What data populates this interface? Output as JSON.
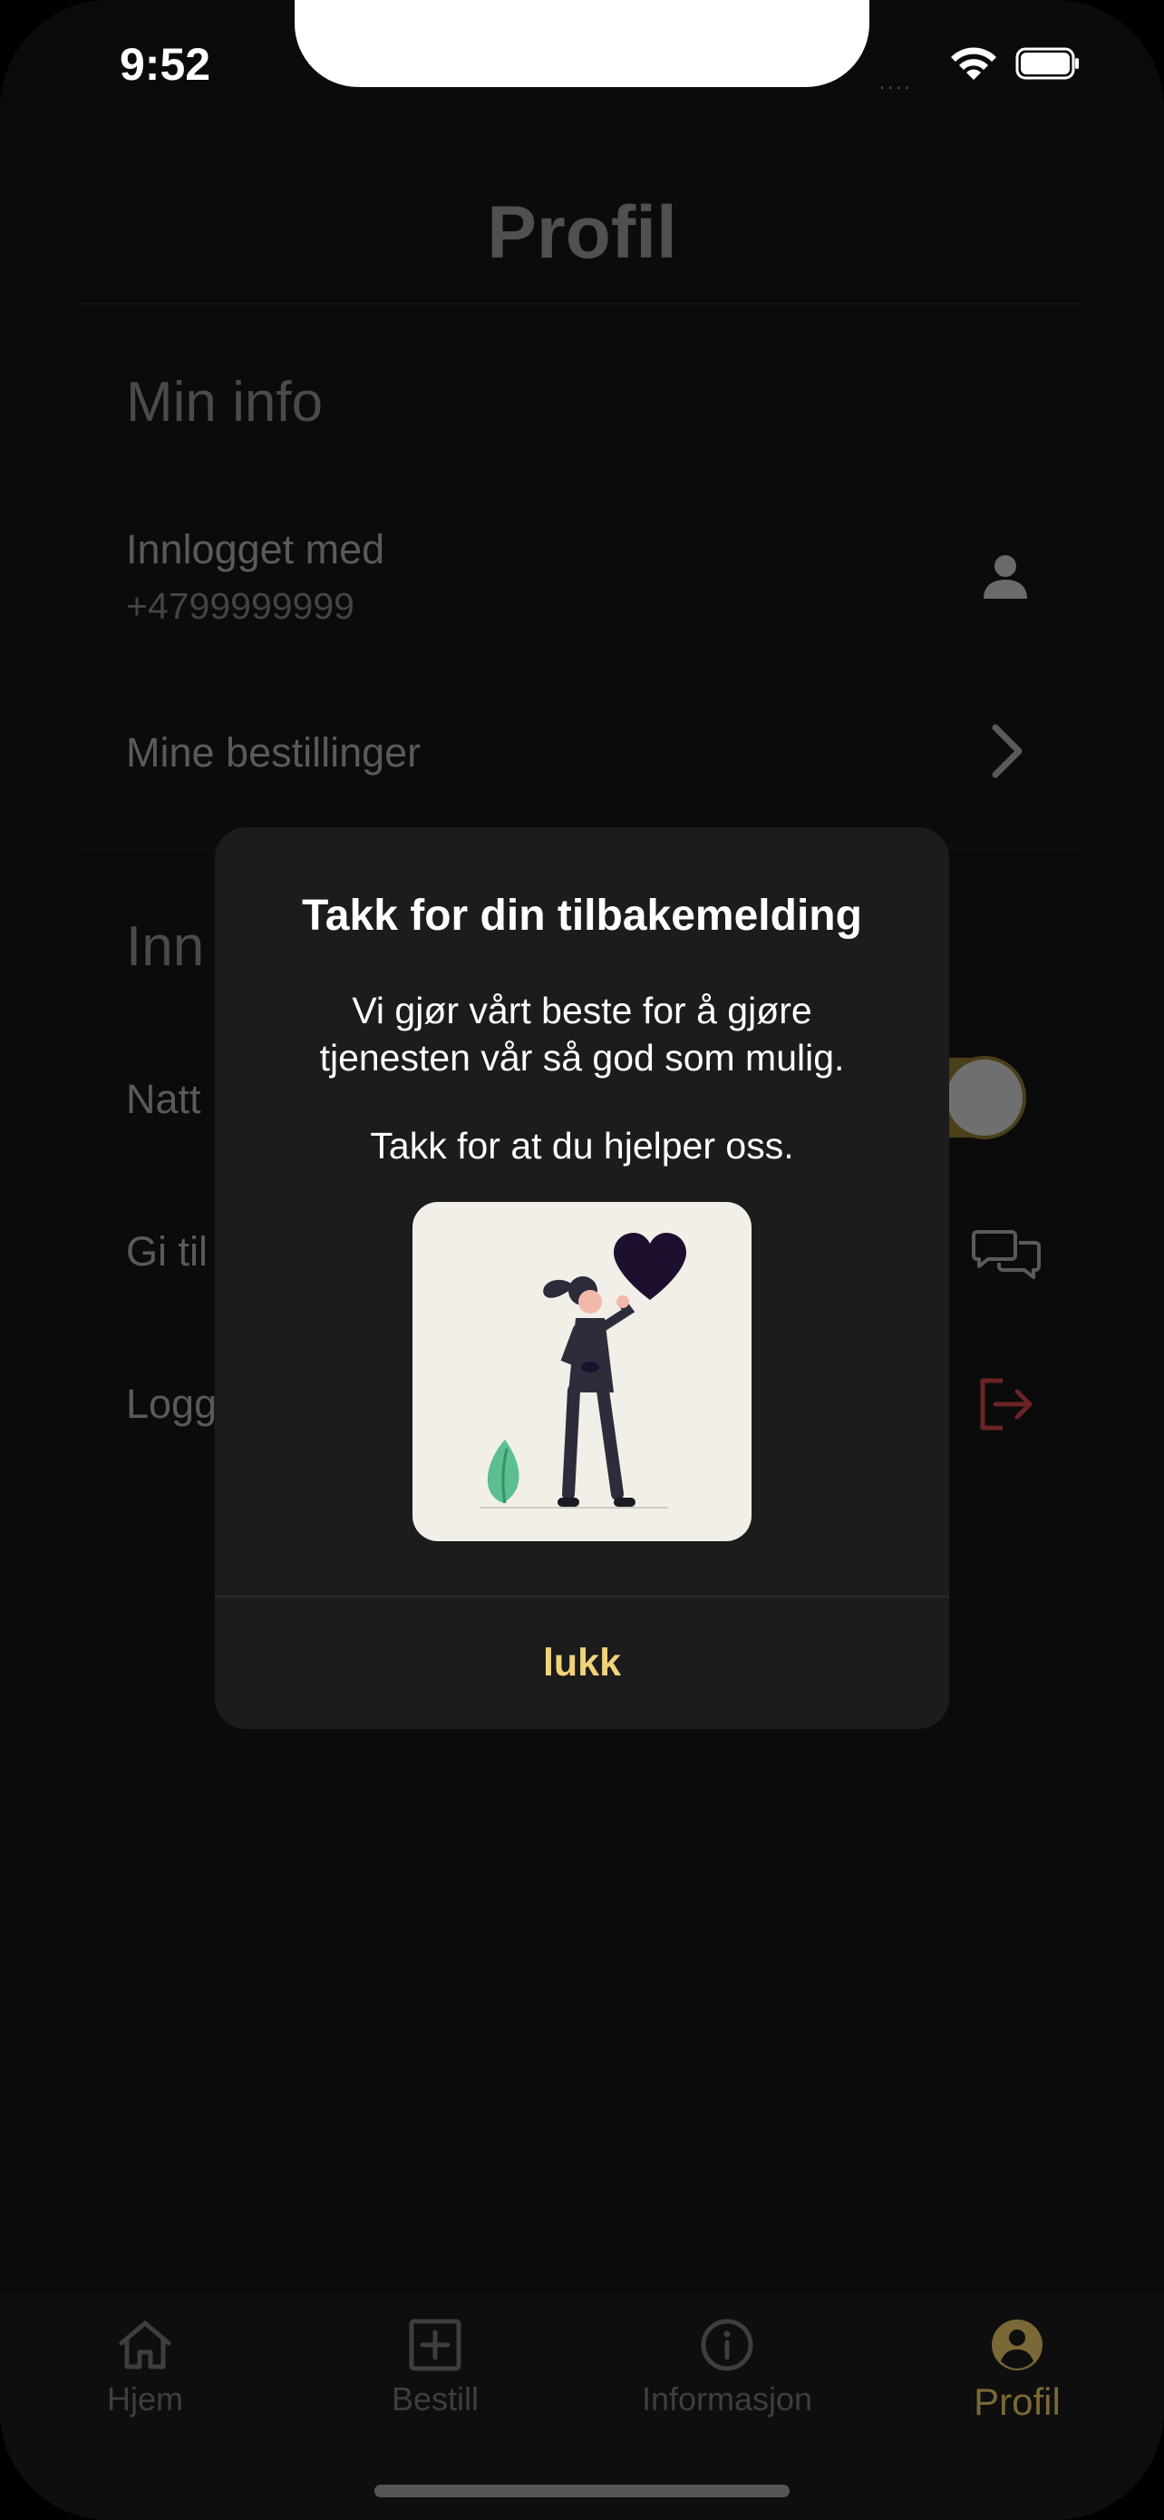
{
  "status_bar": {
    "time": "9:52",
    "signal": "....",
    "wifi_icon": "wifi-icon",
    "battery_icon": "battery-icon"
  },
  "page": {
    "title": "Profil"
  },
  "sections": {
    "min_info": {
      "title": "Min info",
      "logged_in_label": "Innlogget med",
      "phone": "+4799999999",
      "orders_label": "Mine bestillinger"
    },
    "settings": {
      "title_partial": "Inn",
      "night_label_partial": "Natt",
      "feedback_label_partial": "Gi til",
      "logout_label_partial": "Logg"
    }
  },
  "dialog": {
    "title": "Takk for din tilbakemelding",
    "message_line1": "Vi gjør vårt beste for å gjøre",
    "message_line2": "tjenesten vår så god som mulig.",
    "message2": "Takk for at du hjelper oss.",
    "close_label": "lukk"
  },
  "tabbar": {
    "items": [
      {
        "label": "Hjem",
        "icon": "home-icon"
      },
      {
        "label": "Bestill",
        "icon": "plus-square-icon"
      },
      {
        "label": "Informasjon",
        "icon": "info-icon"
      },
      {
        "label": "Profil",
        "icon": "user-circle-icon"
      }
    ],
    "active_index": 3
  },
  "colors": {
    "accent": "#f0d27a",
    "accent_muted": "#7a6836",
    "logout_red": "#6b2424",
    "background": "#0b0b0b",
    "dialog": "#1c1c1c"
  }
}
